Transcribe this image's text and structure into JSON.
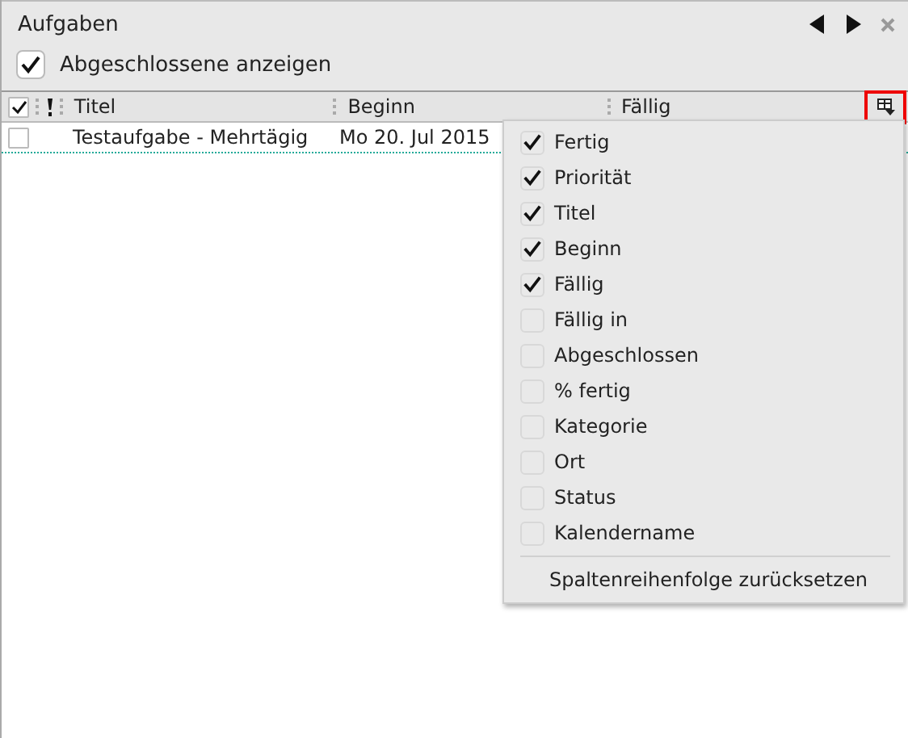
{
  "panel": {
    "title": "Aufgaben",
    "show_completed": {
      "label": "Abgeschlossene anzeigen",
      "checked": true
    }
  },
  "table": {
    "header_checked": true,
    "columns": [
      {
        "label": "Titel"
      },
      {
        "label": "Beginn"
      },
      {
        "label": "Fällig"
      }
    ],
    "rows": [
      {
        "done": false,
        "title": "Testaufgabe - Mehrtägig",
        "start": "Mo 20. Jul 2015"
      }
    ]
  },
  "column_menu": {
    "items": [
      {
        "label": "Fertig",
        "checked": true
      },
      {
        "label": "Priorität",
        "checked": true
      },
      {
        "label": "Titel",
        "checked": true
      },
      {
        "label": "Beginn",
        "checked": true
      },
      {
        "label": "Fällig",
        "checked": true
      },
      {
        "label": "Fällig in",
        "checked": false
      },
      {
        "label": "Abgeschlossen",
        "checked": false
      },
      {
        "label": "% fertig",
        "checked": false
      },
      {
        "label": "Kategorie",
        "checked": false
      },
      {
        "label": "Ort",
        "checked": false
      },
      {
        "label": "Status",
        "checked": false
      },
      {
        "label": "Kalendername",
        "checked": false
      }
    ],
    "reset": "Spaltenreihenfolge zurücksetzen"
  }
}
